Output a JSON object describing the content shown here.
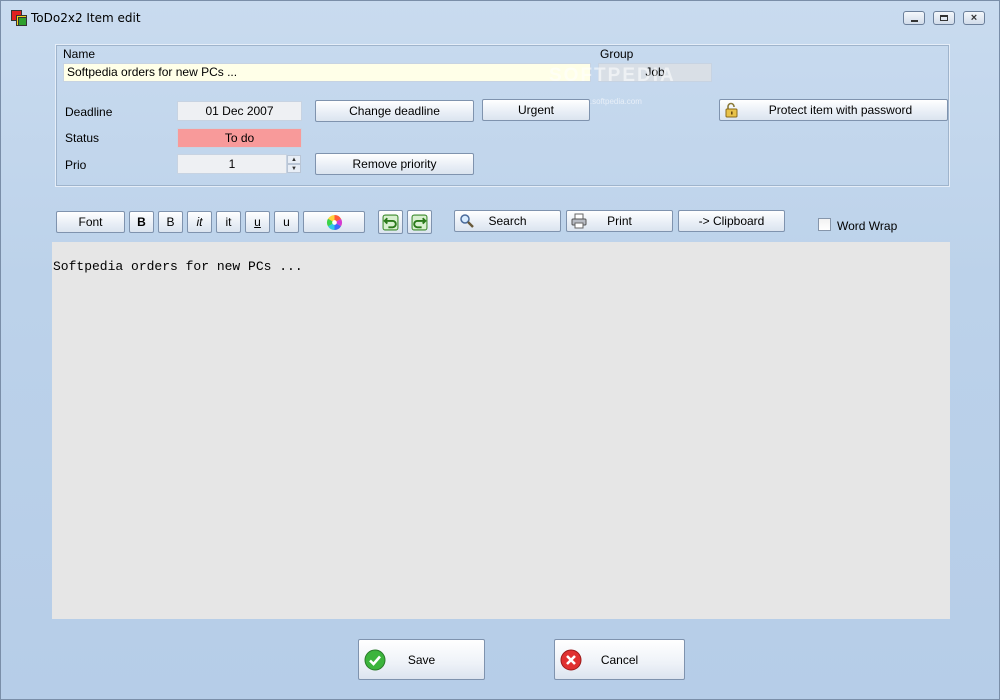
{
  "window": {
    "title": "ToDo2x2 Item edit",
    "close_glyph": "×"
  },
  "form": {
    "name_label": "Name",
    "name_value": "Softpedia orders for new PCs ...",
    "group_label": "Group",
    "group_value": "Job",
    "deadline_label": "Deadline",
    "deadline_value": "01 Dec 2007",
    "change_deadline_label": "Change deadline",
    "urgent_label": "Urgent",
    "protect_label": "Protect item with password",
    "status_label": "Status",
    "status_value": "To do",
    "prio_label": "Prio",
    "prio_value": "1",
    "remove_priority_label": "Remove priority"
  },
  "toolbar": {
    "font_label": "Font",
    "bold_label": "B",
    "bold2_label": "B",
    "italic_label": "it",
    "italic2_label": "it",
    "underline_label": "u",
    "underline2_label": "u",
    "search_label": "Search",
    "print_label": "Print",
    "clipboard_label": "-> Clipboard",
    "word_wrap_label": "Word Wrap"
  },
  "editor": {
    "content": "Softpedia orders for new PCs ..."
  },
  "footer": {
    "save_label": "Save",
    "cancel_label": "Cancel"
  },
  "watermark": {
    "text": "SOFTPEDIA",
    "sub": "www.softpedia.com"
  },
  "colors": {
    "status_bg": "#f89a9a",
    "name_bg": "#ffffe8",
    "editor_bg": "#e6e6e6"
  }
}
